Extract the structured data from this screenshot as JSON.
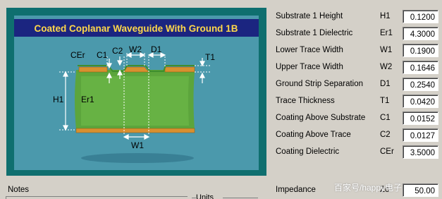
{
  "diagram": {
    "title": "Coated Coplanar Waveguide With Ground 1B",
    "labels": {
      "cer": "CEr",
      "c1": "C1",
      "c2": "C2",
      "w2": "W2",
      "d1": "D1",
      "t1": "T1",
      "h1": "H1",
      "er1": "Er1",
      "w1": "W1"
    }
  },
  "parameters": [
    {
      "label": "Substrate 1 Height",
      "symbol": "H1",
      "value": "0.1200"
    },
    {
      "label": "Substrate 1 Dielectric",
      "symbol": "Er1",
      "value": "4.3000"
    },
    {
      "label": "Lower Trace Width",
      "symbol": "W1",
      "value": "0.1900"
    },
    {
      "label": "Upper Trace Width",
      "symbol": "W2",
      "value": "0.1646"
    },
    {
      "label": "Ground Strip Separation",
      "symbol": "D1",
      "value": "0.2540"
    },
    {
      "label": "Trace Thickness",
      "symbol": "T1",
      "value": "0.0420"
    },
    {
      "label": "Coating Above Substrate",
      "symbol": "C1",
      "value": "0.0152"
    },
    {
      "label": "Coating Above Trace",
      "symbol": "C2",
      "value": "0.0127"
    },
    {
      "label": "Coating Dielectric",
      "symbol": "CEr",
      "value": "3.5000"
    }
  ],
  "impedance": {
    "label": "Impedance",
    "symbol": "Zo",
    "value": "50.00"
  },
  "notes": {
    "label": "Notes"
  },
  "units": {
    "label": "Units"
  },
  "watermark": "百家号/happy电子"
}
